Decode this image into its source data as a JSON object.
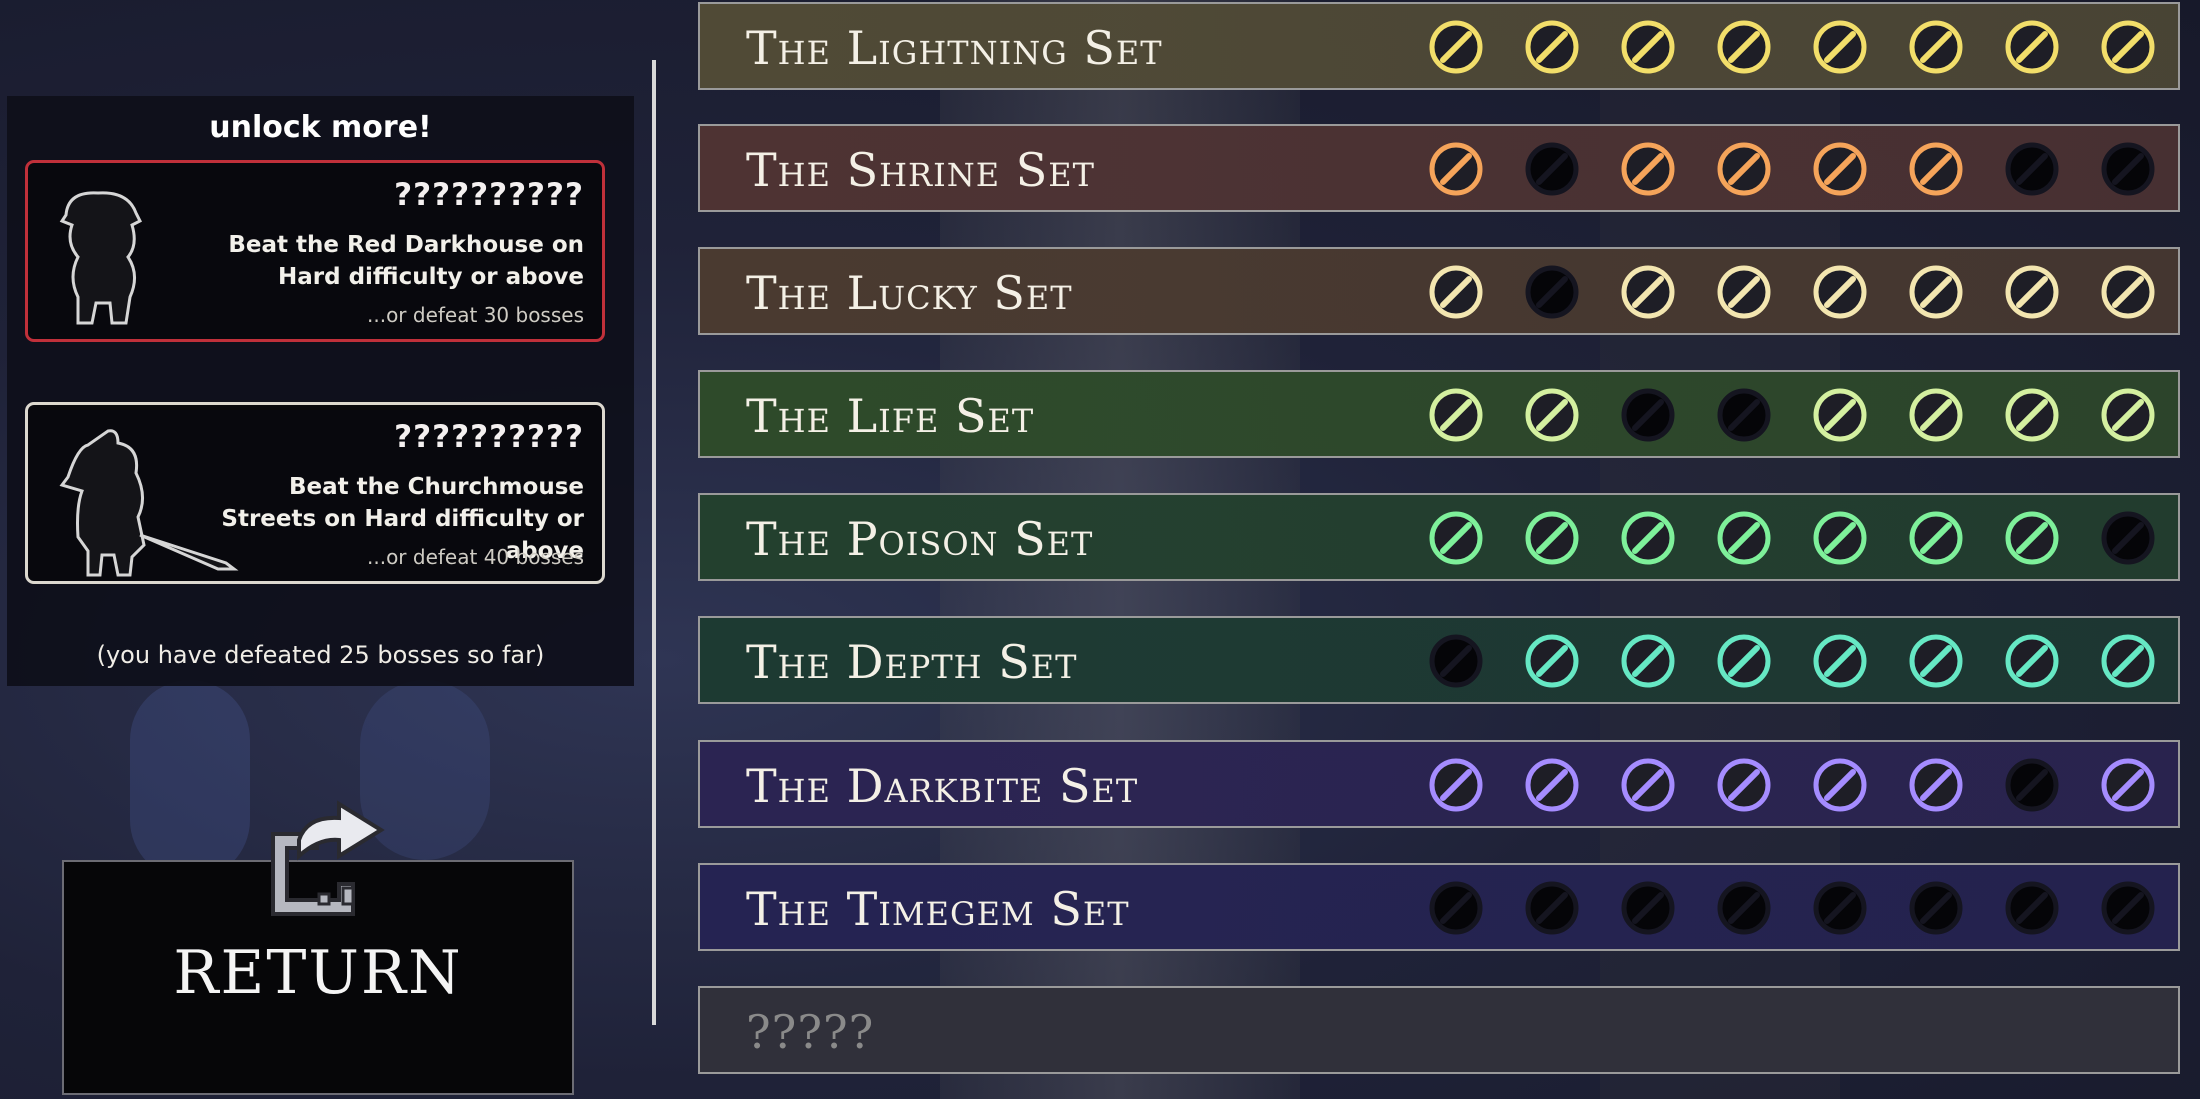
{
  "unlock_panel": {
    "title": "unlock more!",
    "cards": [
      {
        "name_hidden": "??????????",
        "condition": "Beat the Red Darkhouse on Hard difficulty or above",
        "alternative": "...or defeat 30 bosses",
        "border_color": "#c0303a"
      },
      {
        "name_hidden": "??????????",
        "condition": "Beat the Churchmouse Streets on Hard difficulty or above",
        "alternative": "...or defeat 40 bosses",
        "border_color": "#dcd8cf"
      }
    ],
    "defeated_note": "(you have defeated 25 bosses so far)"
  },
  "return_button": {
    "label": "RETURN",
    "icon": "return-arrow-icon"
  },
  "sets": [
    {
      "name": "The Lightning Set",
      "bg": "#504a36",
      "accent": "#f2de6a",
      "items": [
        {
          "icon": "trident",
          "unlocked": true
        },
        {
          "icon": "staff",
          "unlocked": true
        },
        {
          "icon": "crossbow",
          "unlocked": true
        },
        {
          "icon": "twin-blades",
          "unlocked": true
        },
        {
          "icon": "amulet",
          "unlocked": true
        },
        {
          "icon": "dragonfly",
          "unlocked": true
        },
        {
          "icon": "gauntlet",
          "unlocked": true
        },
        {
          "icon": "robe",
          "unlocked": true
        }
      ]
    },
    {
      "name": "The Shrine Set",
      "bg": "#4e3333",
      "accent": "#f5a45a",
      "items": [
        {
          "icon": "sword",
          "unlocked": true
        },
        {
          "icon": "bow",
          "unlocked": false
        },
        {
          "icon": "staff",
          "unlocked": true
        },
        {
          "icon": "torch",
          "unlocked": true
        },
        {
          "icon": "shrine-robe",
          "unlocked": true
        },
        {
          "icon": "bow-ribbon",
          "unlocked": true
        },
        {
          "icon": "ring",
          "unlocked": false
        },
        {
          "icon": "armor",
          "unlocked": false
        }
      ]
    },
    {
      "name": "The Lucky Set",
      "bg": "#4a3a30",
      "accent": "#f3e6b0",
      "items": [
        {
          "icon": "book",
          "unlocked": true
        },
        {
          "icon": "sword",
          "unlocked": false
        },
        {
          "icon": "trumpet",
          "unlocked": true
        },
        {
          "icon": "wand",
          "unlocked": true
        },
        {
          "icon": "dress",
          "unlocked": true
        },
        {
          "icon": "shield",
          "unlocked": true
        },
        {
          "icon": "ring",
          "unlocked": true
        },
        {
          "icon": "magnet",
          "unlocked": true
        }
      ]
    },
    {
      "name": "The Life Set",
      "bg": "#2e4a2a",
      "accent": "#d4f0a0",
      "items": [
        {
          "icon": "potion",
          "unlocked": true
        },
        {
          "icon": "spear",
          "unlocked": true
        },
        {
          "icon": "shield",
          "unlocked": false
        },
        {
          "icon": "bow",
          "unlocked": false
        },
        {
          "icon": "amulet",
          "unlocked": true
        },
        {
          "icon": "bracelet",
          "unlocked": true
        },
        {
          "icon": "dress",
          "unlocked": true
        },
        {
          "icon": "wreath",
          "unlocked": true
        }
      ]
    },
    {
      "name": "The Poison Set",
      "bg": "#23402e",
      "accent": "#7ef09a",
      "items": [
        {
          "icon": "dagger",
          "unlocked": true
        },
        {
          "icon": "staff",
          "unlocked": true
        },
        {
          "icon": "cauldron",
          "unlocked": true
        },
        {
          "icon": "bow",
          "unlocked": true
        },
        {
          "icon": "gauntlet",
          "unlocked": true
        },
        {
          "icon": "necklace",
          "unlocked": true
        },
        {
          "icon": "helmet",
          "unlocked": true
        },
        {
          "icon": "cloak",
          "unlocked": false
        }
      ]
    },
    {
      "name": "The Depth Set",
      "bg": "#1d3a32",
      "accent": "#66e8c4",
      "items": [
        {
          "icon": "shell",
          "unlocked": false
        },
        {
          "icon": "tome",
          "unlocked": true
        },
        {
          "icon": "sword",
          "unlocked": true
        },
        {
          "icon": "scythe",
          "unlocked": true
        },
        {
          "icon": "armor",
          "unlocked": true
        },
        {
          "icon": "mask",
          "unlocked": true
        },
        {
          "icon": "orb",
          "unlocked": true
        },
        {
          "icon": "necklace",
          "unlocked": true
        }
      ]
    },
    {
      "name": "The Darkbite Set",
      "bg": "#2b2452",
      "accent": "#a58cff",
      "items": [
        {
          "icon": "knife",
          "unlocked": true
        },
        {
          "icon": "blade",
          "unlocked": true
        },
        {
          "icon": "claw-book",
          "unlocked": true
        },
        {
          "icon": "orb",
          "unlocked": true
        },
        {
          "icon": "gauntlet",
          "unlocked": true
        },
        {
          "icon": "glasses",
          "unlocked": true
        },
        {
          "icon": "ring",
          "unlocked": false
        },
        {
          "icon": "crown",
          "unlocked": true
        }
      ]
    },
    {
      "name": "The Timegem Set",
      "bg": "#252352",
      "accent": "#8a86e0",
      "items": [
        {
          "icon": "stick",
          "unlocked": false
        },
        {
          "icon": "spear",
          "unlocked": false
        },
        {
          "icon": "dagger",
          "unlocked": false
        },
        {
          "icon": "shield",
          "unlocked": false
        },
        {
          "icon": "ring",
          "unlocked": false
        },
        {
          "icon": "glasses",
          "unlocked": false
        },
        {
          "icon": "orb",
          "unlocked": false
        },
        {
          "icon": "boots",
          "unlocked": false
        }
      ]
    }
  ],
  "locked_set": {
    "name": "?????",
    "bg": "#30303a"
  }
}
